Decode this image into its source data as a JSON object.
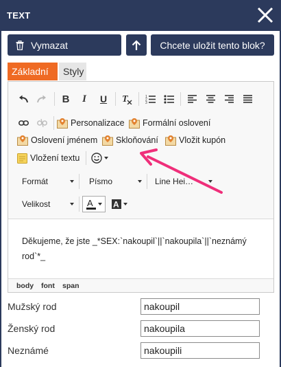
{
  "header": {
    "title": "TEXT"
  },
  "actions": {
    "clear_label": "Vymazat",
    "save_block_label": "Chcete uložit tento blok?"
  },
  "tabs": {
    "basic": "Základní",
    "styles": "Styly"
  },
  "toolbar": {
    "personalization": "Personalizace",
    "formal_greeting": "Formální oslovení",
    "greeting_by_name": "Oslovení jménem",
    "declension": "Skloňování",
    "insert_coupon": "Vložit kupón",
    "insert_text": "Vložení textu",
    "format": "Formát",
    "font": "Písmo",
    "line_height": "Line Hei…",
    "size": "Velikost"
  },
  "content": {
    "text": "Děkujeme, že jste _*SEX:`nakoupil`||`nakoupila`||`neznámý rod`*_"
  },
  "elements_path": [
    "body",
    "font",
    "span"
  ],
  "form": {
    "male_label": "Mužský rod",
    "male_value": "nakoupil",
    "female_label": "Ženský rod",
    "female_value": "nakoupila",
    "unknown_label": "Neznámé",
    "unknown_value": "nakoupili"
  },
  "colors": {
    "header": "#2c3a5c",
    "accent_tab": "#ef6a23",
    "annotation_arrow": "#ef2f7a"
  }
}
